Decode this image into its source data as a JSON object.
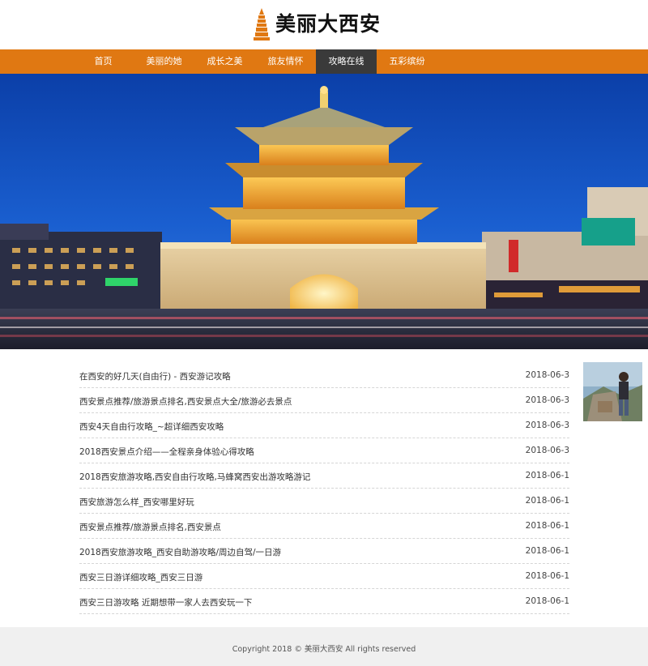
{
  "site": {
    "title": "美丽大西安",
    "logo_icon": "pagoda-icon",
    "accent_color": "#e07812",
    "active_nav_color": "#3a3a3a"
  },
  "nav": {
    "items": [
      {
        "label": "首页"
      },
      {
        "label": "美丽的她"
      },
      {
        "label": "成长之美"
      },
      {
        "label": "旅友情怀"
      },
      {
        "label": "攻略在线"
      },
      {
        "label": "五彩缤纷"
      }
    ],
    "active_label": "攻略在线"
  },
  "banner": {
    "image": "xian-bell-tower-night-photo"
  },
  "articles": [
    {
      "title": "在西安的好几天(自由行) - 西安游记攻略",
      "date": "2018-06-3"
    },
    {
      "title": "西安景点推荐/旅游景点排名,西安景点大全/旅游必去景点",
      "date": "2018-06-3"
    },
    {
      "title": "西安4天自由行攻略_~超详细西安攻略",
      "date": "2018-06-3"
    },
    {
      "title": "2018西安景点介绍——全程亲身体验心得攻略",
      "date": "2018-06-3"
    },
    {
      "title": "2018西安旅游攻略,西安自由行攻略,马蜂窝西安出游攻略游记",
      "date": "2018-06-1"
    },
    {
      "title": "西安旅游怎么样_西安哪里好玩",
      "date": "2018-06-1"
    },
    {
      "title": "西安景点推荐/旅游景点排名,西安景点",
      "date": "2018-06-1"
    },
    {
      "title": "2018西安旅游攻略_西安自助游攻略/周边自驾/一日游",
      "date": "2018-06-1"
    },
    {
      "title": "西安三日游详细攻略_西安三日游",
      "date": "2018-06-1"
    },
    {
      "title": "西安三日游攻略 近期想带一家人去西安玩一下",
      "date": "2018-06-1"
    }
  ],
  "side": {
    "photo": "traveler-photo"
  },
  "footer": {
    "text": "Copyright 2018 © 美丽大西安 All rights reserved"
  }
}
